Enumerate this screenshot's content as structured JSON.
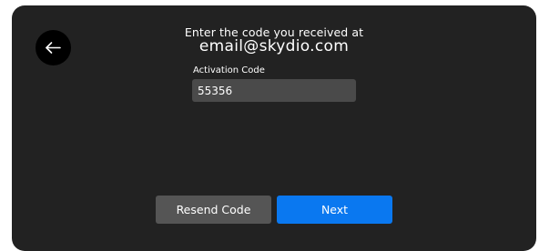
{
  "header": {
    "prompt": "Enter the code you received at",
    "email": "email@skydio.com"
  },
  "back": {
    "icon": "arrow-left-icon"
  },
  "form": {
    "label": "Activation Code",
    "value": "55356"
  },
  "actions": {
    "resend_label": "Resend Code",
    "next_label": "Next"
  },
  "colors": {
    "panel": "#222222",
    "accent": "#0a78f0",
    "secondary_button": "#555555",
    "input_bg": "#4a4a4a"
  }
}
